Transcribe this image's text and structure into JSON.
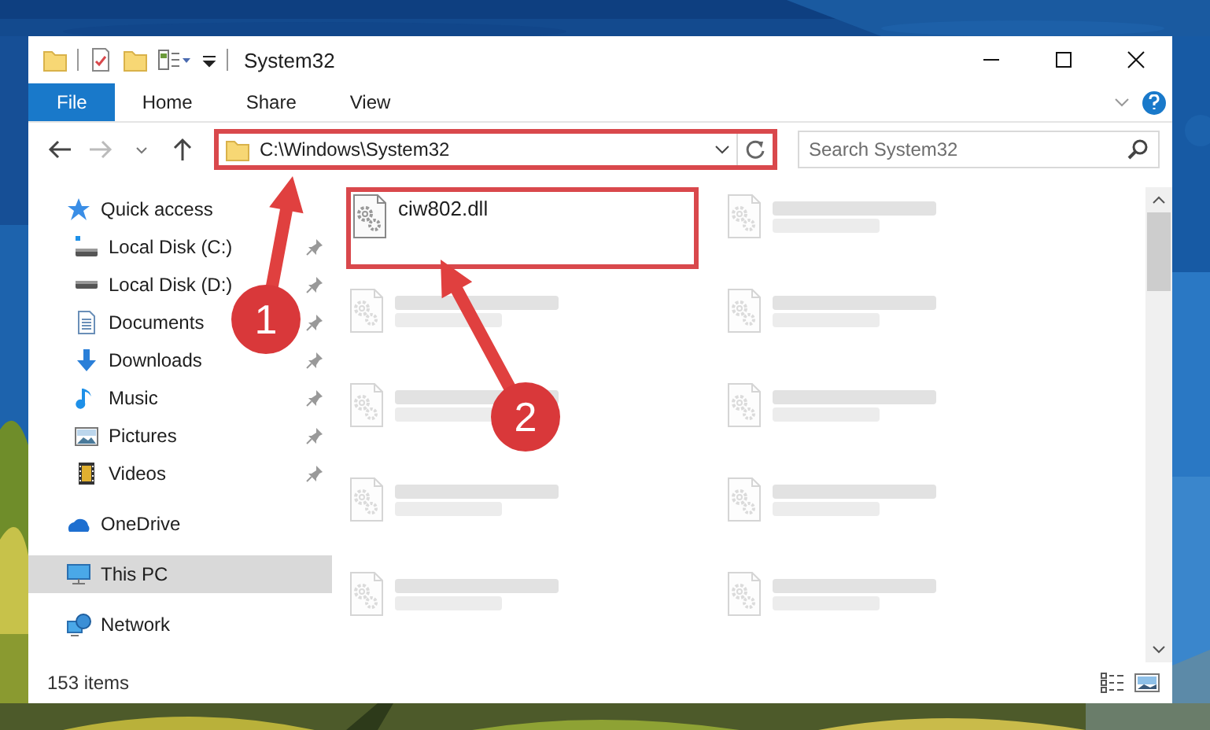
{
  "window": {
    "title": "System32"
  },
  "ribbon_tabs": [
    {
      "label": "File",
      "selected": true
    },
    {
      "label": "Home",
      "selected": false
    },
    {
      "label": "Share",
      "selected": false
    },
    {
      "label": "View",
      "selected": false
    }
  ],
  "address_bar": {
    "value": "C:\\Windows\\System32",
    "highlighted": true
  },
  "search": {
    "placeholder": "Search System32"
  },
  "sidebar": {
    "items": [
      {
        "label": "Quick access",
        "selected": false,
        "children": [
          {
            "label": "Local Disk (C:)",
            "pinned": true,
            "selected": false
          },
          {
            "label": "Local Disk (D:)",
            "pinned": true,
            "selected": false
          },
          {
            "label": "Documents",
            "pinned": true,
            "selected": false
          },
          {
            "label": "Downloads",
            "pinned": true,
            "selected": false
          },
          {
            "label": "Music",
            "pinned": true,
            "selected": false
          },
          {
            "label": "Pictures",
            "pinned": true,
            "selected": false
          },
          {
            "label": "Videos",
            "pinned": true,
            "selected": false
          }
        ]
      },
      {
        "label": "OneDrive",
        "selected": false
      },
      {
        "label": "This PC",
        "selected": true
      },
      {
        "label": "Network",
        "selected": false
      }
    ]
  },
  "files": [
    {
      "kind": "file",
      "name": "ciw802.dll",
      "highlighted": true
    },
    {
      "kind": "blurred",
      "highlighted": false
    },
    {
      "kind": "blurred",
      "highlighted": false
    },
    {
      "kind": "blurred",
      "highlighted": false
    },
    {
      "kind": "blurred",
      "highlighted": false
    },
    {
      "kind": "blurred",
      "highlighted": false
    },
    {
      "kind": "blurred",
      "highlighted": false
    },
    {
      "kind": "blurred",
      "highlighted": false
    },
    {
      "kind": "blurred",
      "highlighted": false
    },
    {
      "kind": "blurred",
      "highlighted": false
    }
  ],
  "status_bar": {
    "count": "153 items"
  },
  "callouts": [
    {
      "number": "1"
    },
    {
      "number": "2"
    }
  ]
}
